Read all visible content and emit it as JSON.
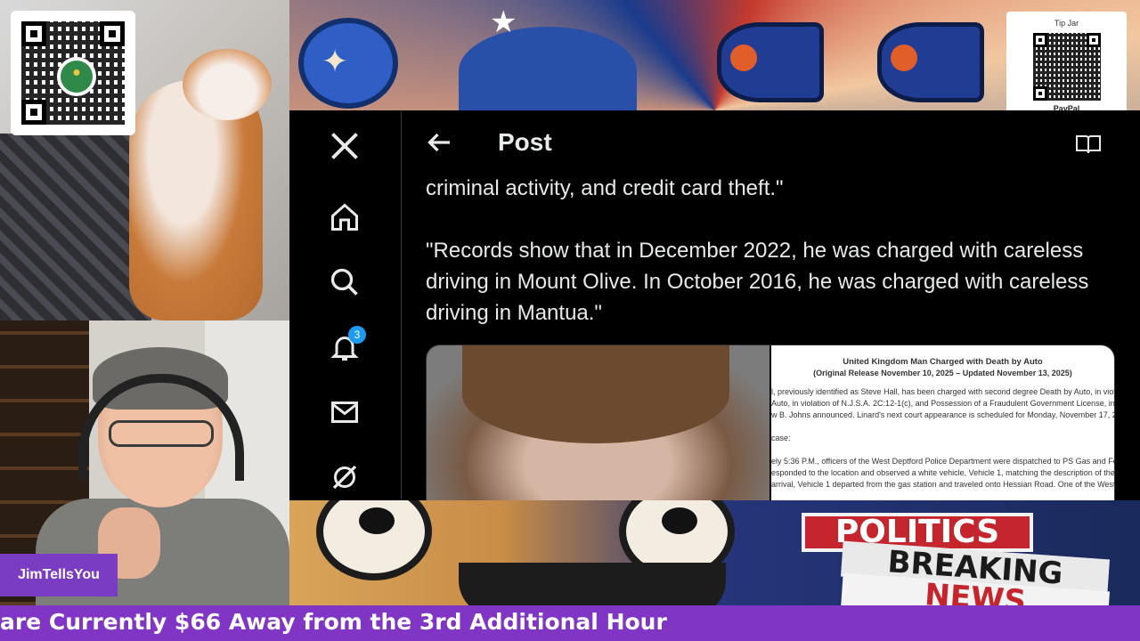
{
  "stream": {
    "streamer_name": "JimTellsYou",
    "ticker_text": "are Currently $66 Away from the 3rd Additional Hour",
    "tip_jar": {
      "label": "Tip Jar",
      "provider": "PayPal"
    }
  },
  "banners": {
    "bottom": {
      "politics": "POLITICS",
      "breaking": "BREAKING",
      "news": "NEWS"
    }
  },
  "x_app": {
    "nav": [
      {
        "icon": "x-logo-icon"
      },
      {
        "icon": "home-icon"
      },
      {
        "icon": "search-icon"
      },
      {
        "icon": "bell-icon",
        "badge": "3"
      },
      {
        "icon": "mail-icon"
      },
      {
        "icon": "grok-icon"
      }
    ],
    "header": {
      "title": "Post"
    },
    "post": {
      "paragraphs": [
        "criminal activity, and credit card theft.\"",
        "\"Records show that in December 2022, he was charged with careless driving in Mount Olive. In October 2016, he was charged with careless driving in Mantua.\""
      ],
      "document": {
        "title": "United Kingdom Man Charged with Death by Auto",
        "subtitle": "(Original Release November 10, 2025 – Updated November 13, 2025)",
        "lines": [
          "l, previously identified as Steve Hall, has been charged with second degree Death by Auto, in viol",
          "Auto, in violation of N.J.S.A. 2C:12-1(c), and Possession of a Fraudulent Government License, in viol",
          "w B. Johns announced. Linard's next court appearance is scheduled for Monday, November 17, 20",
          "",
          "case:",
          "",
          "ely 5:36 P.M., officers of the West Deptford Police Department were dispatched to PS Gas and Fo",
          "esponded to the location and observed a white vehicle, Vehicle 1, matching the description of the",
          "arrival, Vehicle 1 departed from the gas station and traveled onto Hessian Road. One of the West"
        ]
      }
    }
  },
  "colors": {
    "accent": "#1d9bf0",
    "ticker_bg": "#8035c4",
    "name_tag_bg": "#7a3cc2",
    "politics_red": "#c5252c"
  }
}
